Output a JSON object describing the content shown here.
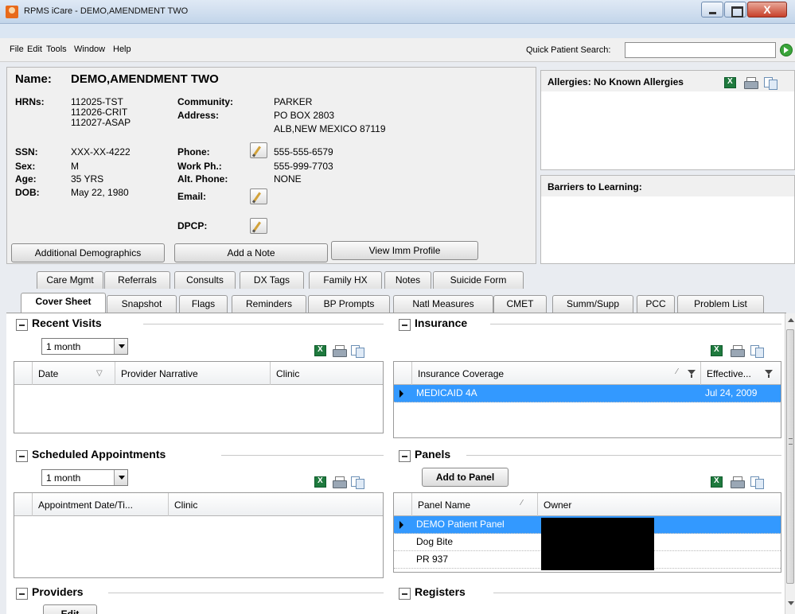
{
  "window": {
    "title": "RPMS iCare - DEMO,AMENDMENT TWO",
    "close_glyph": "X"
  },
  "menu": {
    "items": [
      "File",
      "Edit",
      "Tools",
      "Window",
      "Help"
    ],
    "quick_search_label": "Quick Patient Search:",
    "quick_search_value": ""
  },
  "patient": {
    "name_label": "Name:",
    "name": "DEMO,AMENDMENT TWO",
    "hrns_label": "HRNs:",
    "hrns": [
      "112025-TST",
      "112026-CRIT",
      "112027-ASAP"
    ],
    "ssn_label": "SSN:",
    "ssn": "XXX-XX-4222",
    "sex_label": "Sex:",
    "sex": "M",
    "age_label": "Age:",
    "age": "35 YRS",
    "dob_label": "DOB:",
    "dob": "May 22, 1980",
    "community_label": "Community:",
    "community": "PARKER",
    "address_label": "Address:",
    "address": [
      "PO BOX 2803",
      "ALB,NEW MEXICO 87119"
    ],
    "phone_label": "Phone:",
    "phone": "555-555-6579",
    "workph_label": "Work Ph.:",
    "workph": "555-999-7703",
    "altphone_label": "Alt. Phone:",
    "altphone": "NONE",
    "email_label": "Email:",
    "dpcp_label": "DPCP:"
  },
  "buttons": {
    "demographics": "Additional Demographics",
    "add_note": "Add a Note",
    "imm_profile": "View Imm Profile"
  },
  "allergies": {
    "title": "Allergies: No Known Allergies"
  },
  "barriers": {
    "title": "Barriers to Learning:"
  },
  "tabs_row1": [
    "Care Mgmt",
    "Referrals",
    "Consults",
    "DX Tags",
    "Family HX",
    "Notes",
    "Suicide Form"
  ],
  "tabs_row2": [
    "Cover Sheet",
    "Snapshot",
    "Flags",
    "Reminders",
    "BP Prompts",
    "Natl Measures",
    "CMET",
    "Summ/Supp",
    "PCC",
    "Problem List"
  ],
  "recent_visits": {
    "title": "Recent Visits",
    "range": "1 month",
    "columns": [
      "Date",
      "Provider Narrative",
      "Clinic"
    ]
  },
  "scheduled": {
    "title": "Scheduled Appointments",
    "range": "1 month",
    "columns": [
      "Appointment Date/Ti...",
      "Clinic"
    ]
  },
  "insurance": {
    "title": "Insurance",
    "columns": [
      "Insurance Coverage",
      "Effective..."
    ],
    "rows": [
      [
        "MEDICAID 4A",
        "Jul 24, 2009"
      ]
    ]
  },
  "panels": {
    "title": "Panels",
    "add_button": "Add to Panel",
    "columns": [
      "Panel Name",
      "Owner"
    ],
    "rows": [
      "DEMO Patient Panel",
      "Dog Bite",
      "PR 937"
    ]
  },
  "providers": {
    "title": "Providers",
    "edit_button": "Edit"
  },
  "registers": {
    "title": "Registers"
  }
}
